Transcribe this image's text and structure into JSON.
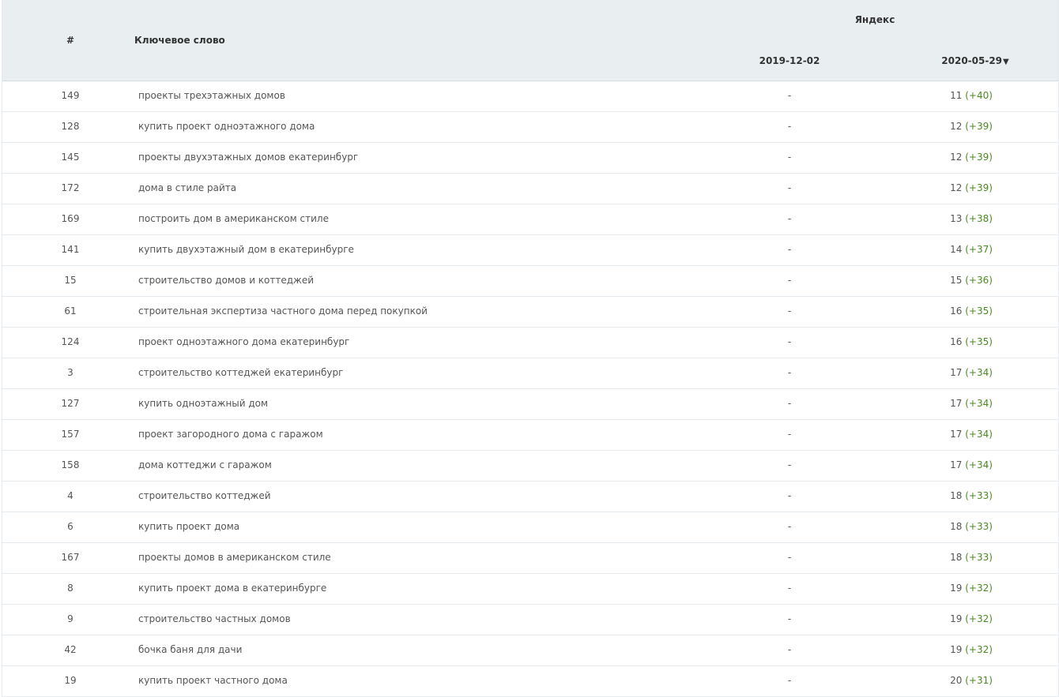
{
  "header": {
    "num": "#",
    "keyword": "Ключевое слово",
    "engine": "Яндекс",
    "date1": "2019-12-02",
    "date2": "2020-05-29",
    "sort_arrow": "▼"
  },
  "colors": {
    "header_bg": "#e9eef1",
    "sorted_link": "#4a74a8",
    "positive_delta": "#4b8a23"
  },
  "rows": [
    {
      "num": "149",
      "keyword": "проекты трехэтажных домов",
      "d1": "-",
      "pos": "11",
      "delta": "(+40)"
    },
    {
      "num": "128",
      "keyword": "купить проект одноэтажного дома",
      "d1": "-",
      "pos": "12",
      "delta": "(+39)"
    },
    {
      "num": "145",
      "keyword": "проекты двухэтажных домов екатеринбург",
      "d1": "-",
      "pos": "12",
      "delta": "(+39)"
    },
    {
      "num": "172",
      "keyword": "дома в стиле райта",
      "d1": "-",
      "pos": "12",
      "delta": "(+39)"
    },
    {
      "num": "169",
      "keyword": "построить дом в американском стиле",
      "d1": "-",
      "pos": "13",
      "delta": "(+38)"
    },
    {
      "num": "141",
      "keyword": "купить двухэтажный дом в екатеринбурге",
      "d1": "-",
      "pos": "14",
      "delta": "(+37)"
    },
    {
      "num": "15",
      "keyword": "строительство домов и коттеджей",
      "d1": "-",
      "pos": "15",
      "delta": "(+36)"
    },
    {
      "num": "61",
      "keyword": "строительная экспертиза частного дома перед покупкой",
      "d1": "-",
      "pos": "16",
      "delta": "(+35)"
    },
    {
      "num": "124",
      "keyword": "проект одноэтажного дома екатеринбург",
      "d1": "-",
      "pos": "16",
      "delta": "(+35)"
    },
    {
      "num": "3",
      "keyword": "строительство коттеджей екатеринбург",
      "d1": "-",
      "pos": "17",
      "delta": "(+34)"
    },
    {
      "num": "127",
      "keyword": "купить одноэтажный дом",
      "d1": "-",
      "pos": "17",
      "delta": "(+34)"
    },
    {
      "num": "157",
      "keyword": "проект загородного дома с гаражом",
      "d1": "-",
      "pos": "17",
      "delta": "(+34)"
    },
    {
      "num": "158",
      "keyword": "дома коттеджи с гаражом",
      "d1": "-",
      "pos": "17",
      "delta": "(+34)"
    },
    {
      "num": "4",
      "keyword": "строительство коттеджей",
      "d1": "-",
      "pos": "18",
      "delta": "(+33)"
    },
    {
      "num": "6",
      "keyword": "купить проект дома",
      "d1": "-",
      "pos": "18",
      "delta": "(+33)"
    },
    {
      "num": "167",
      "keyword": "проекты домов в американском стиле",
      "d1": "-",
      "pos": "18",
      "delta": "(+33)"
    },
    {
      "num": "8",
      "keyword": "купить проект дома в екатеринбурге",
      "d1": "-",
      "pos": "19",
      "delta": "(+32)"
    },
    {
      "num": "9",
      "keyword": "строительство частных домов",
      "d1": "-",
      "pos": "19",
      "delta": "(+32)"
    },
    {
      "num": "42",
      "keyword": "бочка баня для дачи",
      "d1": "-",
      "pos": "19",
      "delta": "(+32)"
    },
    {
      "num": "19",
      "keyword": "купить проект частного дома",
      "d1": "-",
      "pos": "20",
      "delta": "(+31)"
    }
  ]
}
